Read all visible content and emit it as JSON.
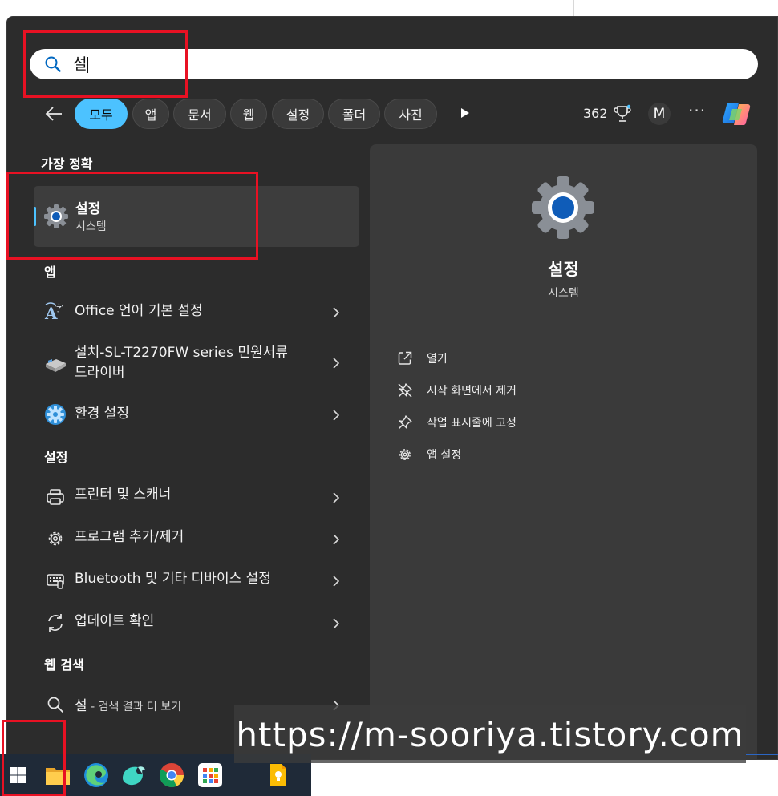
{
  "search": {
    "query": "설"
  },
  "filters": {
    "chips": [
      {
        "label": "모두",
        "active": true
      },
      {
        "label": "앱",
        "active": false
      },
      {
        "label": "문서",
        "active": false
      },
      {
        "label": "웹",
        "active": false
      },
      {
        "label": "설정",
        "active": false
      },
      {
        "label": "폴더",
        "active": false
      },
      {
        "label": "사진",
        "active": false
      }
    ],
    "points": "362",
    "avatar_initial": "M",
    "more_label": "···"
  },
  "best_match": {
    "heading": "가장 정확",
    "title": "설정",
    "subtitle": "시스템"
  },
  "apps": {
    "heading": "앱",
    "items": [
      {
        "label": "Office 언어 기본 설정",
        "icon": "office-language-icon"
      },
      {
        "label": "설치-SL-T2270FW series 민원서류",
        "label2": "드라이버",
        "icon": "printer-installer-icon"
      },
      {
        "label": "환경 설정",
        "icon": "settings-blue-gear-icon"
      }
    ]
  },
  "settings": {
    "heading": "설정",
    "items": [
      {
        "label": "프린터 및 스캐너",
        "icon": "printer-icon"
      },
      {
        "label": "프로그램 추가/제거",
        "icon": "gear-icon"
      },
      {
        "label": "Bluetooth 및 기타 디바이스 설정",
        "icon": "keyboard-icon"
      },
      {
        "label": "업데이트 확인",
        "icon": "refresh-icon"
      }
    ]
  },
  "web_search": {
    "heading": "웹 검색",
    "query": "설",
    "suffix": " - 검색 결과 더 보기"
  },
  "detail": {
    "title": "설정",
    "subtitle": "시스템",
    "actions": [
      {
        "label": "열기",
        "icon": "open-external-icon"
      },
      {
        "label": "시작 화면에서 제거",
        "icon": "unpin-icon"
      },
      {
        "label": "작업 표시줄에 고정",
        "icon": "pin-icon"
      },
      {
        "label": "앱 설정",
        "icon": "gear-icon"
      }
    ]
  },
  "watermark": "https://m-sooriya.tistory.com",
  "colors": {
    "accent": "#4cc2ff",
    "panel": "#2c2c2c",
    "annotation": "#e81123"
  }
}
